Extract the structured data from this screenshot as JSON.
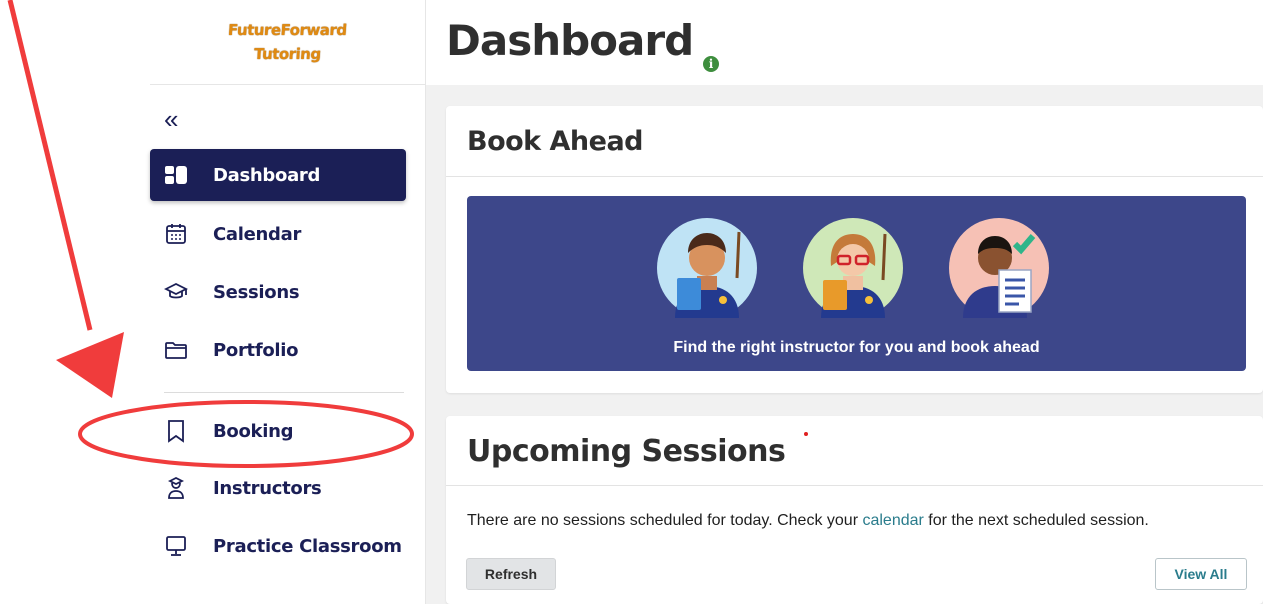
{
  "brand": {
    "line1": "FutureForward",
    "line2": "Tutoring"
  },
  "sidebar": {
    "collapse_glyph": "«",
    "items": [
      {
        "label": "Dashboard",
        "icon": "dashboard-icon",
        "active": true
      },
      {
        "label": "Calendar",
        "icon": "calendar-icon"
      },
      {
        "label": "Sessions",
        "icon": "graduation-cap-icon"
      },
      {
        "label": "Portfolio",
        "icon": "folder-icon"
      },
      {
        "label": "Booking",
        "icon": "bookmark-icon"
      },
      {
        "label": "Instructors",
        "icon": "instructor-icon"
      },
      {
        "label": "Practice Classroom",
        "icon": "monitor-icon"
      }
    ]
  },
  "header": {
    "title": "Dashboard",
    "info_glyph": "i"
  },
  "book_ahead": {
    "title": "Book Ahead",
    "banner_caption": "Find the right instructor for you and book ahead"
  },
  "upcoming": {
    "title": "Upcoming Sessions",
    "message_before": "There are no sessions scheduled for today. Check your ",
    "message_link": "calendar",
    "message_after": " for the next scheduled session.",
    "refresh_label": "Refresh",
    "view_all_label": "View All"
  },
  "colors": {
    "nav_active": "#1b1f56",
    "banner": "#3d478a",
    "link": "#2a7c8c",
    "annotation": "#f03c3c",
    "info": "#3e8e3e"
  }
}
